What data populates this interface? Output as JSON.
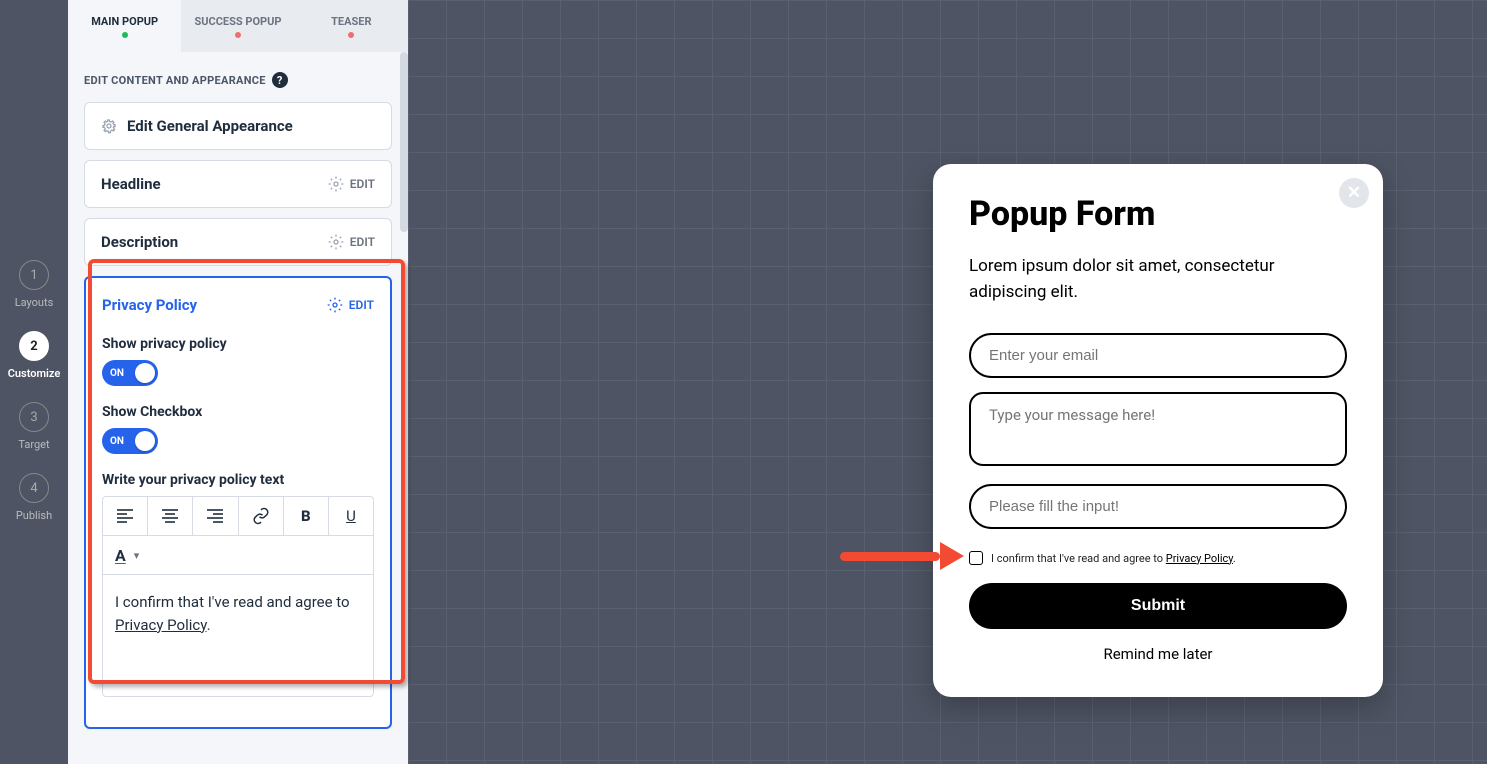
{
  "steps": [
    {
      "num": "1",
      "label": "Layouts"
    },
    {
      "num": "2",
      "label": "Customize"
    },
    {
      "num": "3",
      "label": "Target"
    },
    {
      "num": "4",
      "label": "Publish"
    }
  ],
  "active_step": 1,
  "tabs": [
    "MAIN POPUP",
    "SUCCESS POPUP",
    "TEASER"
  ],
  "active_tab": 0,
  "section_header": "EDIT CONTENT AND APPEARANCE",
  "cards": {
    "general": "Edit General Appearance",
    "headline": "Headline",
    "description": "Description",
    "edit_label": "EDIT"
  },
  "privacy": {
    "title": "Privacy Policy",
    "edit": "EDIT",
    "show_policy_label": "Show privacy policy",
    "show_checkbox_label": "Show Checkbox",
    "toggle_on": "ON",
    "write_label": "Write your privacy policy text",
    "editor_prefix": "I confirm that I've read and agree to ",
    "editor_link": "Privacy Policy",
    "editor_suffix": "."
  },
  "popup": {
    "title": "Popup Form",
    "desc": "Lorem ipsum dolor sit amet, consectetur adipiscing elit.",
    "email_placeholder": "Enter your email",
    "msg_placeholder": "Type your message here!",
    "input3_placeholder": "Please fill the input!",
    "confirm_prefix": "I confirm that I've read and agree to ",
    "confirm_link": "Privacy Policy",
    "confirm_suffix": ".",
    "submit": "Submit",
    "remind": "Remind me later"
  }
}
